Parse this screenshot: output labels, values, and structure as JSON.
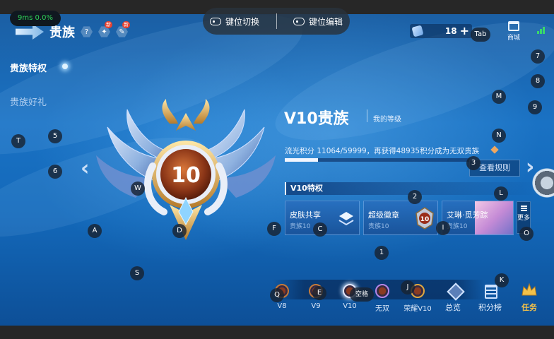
{
  "perf_overlay": "9ms  0.0%",
  "keymap_bar": {
    "switch_label": "键位切换",
    "edit_label": "键位编辑"
  },
  "header": {
    "title": "贵族",
    "help_glyph": "?",
    "new_badge": "新",
    "currency_value": "18",
    "plus_glyph": "+",
    "shop_label": "商城"
  },
  "sidebar": {
    "items": [
      {
        "label": "贵族特权"
      },
      {
        "label": "贵族好礼"
      }
    ]
  },
  "rank": {
    "emblem_number": "10",
    "title": "V10贵族",
    "subtitle": "我的等级",
    "points_text": "流光积分 11064/59999，再获得48935积分成为无双贵族",
    "progress_fraction": 0.18,
    "rules_button": "查看规则"
  },
  "privileges": {
    "header": "V10特权",
    "cards": [
      {
        "title": "皮肤共享",
        "sub": "贵族10"
      },
      {
        "title": "超级徽章",
        "sub": "贵族10"
      },
      {
        "title": "艾琳·觅芳踪",
        "sub": "贵族10"
      }
    ],
    "more_label": "更多"
  },
  "tiers": [
    {
      "label": "V8",
      "color": "#c47a3a"
    },
    {
      "label": "V9",
      "color": "#c47a3a"
    },
    {
      "label": "V10",
      "color": "#e2e8ff"
    },
    {
      "label": "无双",
      "color": "#b486e8"
    },
    {
      "label": "荣耀V10",
      "color": "#e0a840"
    }
  ],
  "bottom_nav": {
    "overview": "总览",
    "leaderboard": "积分榜",
    "tasks": "任务"
  },
  "key_hints": {
    "tab": "Tab",
    "k7": "7",
    "k8": "8",
    "k9": "9",
    "m": "M",
    "n": "N",
    "k3": "3",
    "l": "L",
    "o": "O",
    "k2": "2",
    "i": "I",
    "c": "C",
    "f": "F",
    "k1": "1",
    "k": "K",
    "j": "J",
    "space": "空格",
    "e": "E",
    "q": "Q",
    "t": "T",
    "k5": "5",
    "k6": "6",
    "w": "W",
    "a": "A",
    "d": "D",
    "s": "S"
  }
}
